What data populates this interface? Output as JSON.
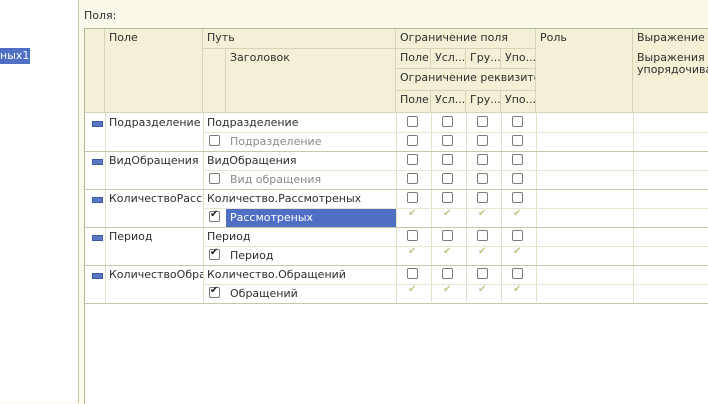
{
  "left_panel": {
    "selected_item": "ных1"
  },
  "fields_label": "Поля:",
  "columns": {
    "field": "Поле",
    "path": "Путь",
    "title": "Заголовок",
    "field_restriction": "Ограничение поля",
    "restriction_cols": [
      "Поле",
      "Усл...",
      "Гру...",
      "Упо..."
    ],
    "attribute_restriction": "Ограничение реквизитов",
    "attribute_cols": [
      "Поле",
      "Усл...",
      "Гру...",
      "Упо..."
    ],
    "role": "Роль",
    "order_expression": "Выражение пр",
    "order_expression_sub": "Выражения упорядочивания"
  },
  "rows": [
    {
      "field": "Подразделение",
      "path": "Подразделение",
      "title": "Подразделение",
      "title_checked": false,
      "title_selected": false
    },
    {
      "field": "ВидОбращения",
      "path": "ВидОбращения",
      "title": "Вид обращения",
      "title_checked": false,
      "title_selected": false
    },
    {
      "field": "КоличествоРасс",
      "path": "Количество.Рассмотреных",
      "title": "Рассмотреных",
      "title_checked": true,
      "title_selected": true
    },
    {
      "field": "Период",
      "path": "Период",
      "title": "Период",
      "title_checked": true,
      "title_selected": false
    },
    {
      "field": "КоличествоОбра",
      "path": "Количество.Обращений",
      "title": "Обращений",
      "title_checked": true,
      "title_selected": false
    }
  ]
}
